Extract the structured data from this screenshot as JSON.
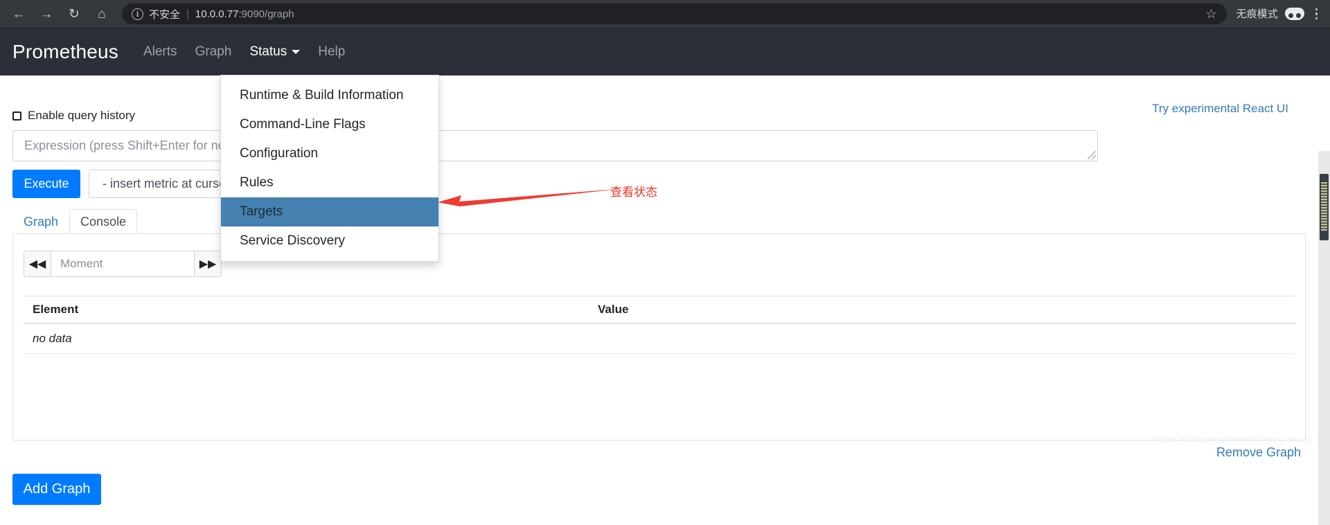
{
  "browser": {
    "back_icon": "back-arrow-icon",
    "forward_icon": "forward-arrow-icon",
    "reload_icon": "reload-icon",
    "home_icon": "home-icon",
    "info_icon": "info-icon",
    "security_label": "不安全",
    "url_separator": "|",
    "url_host": "10.0.0.77",
    "url_rest": ":9090/graph",
    "star_icon": "bookmark-star-icon",
    "incognito_label": "无痕模式",
    "incognito_icon": "incognito-glasses-icon",
    "menu_icon": "three-dot-menu-icon"
  },
  "navbar": {
    "brand": "Prometheus",
    "links": [
      {
        "label": "Alerts",
        "active": false
      },
      {
        "label": "Graph",
        "active": false
      },
      {
        "label": "Status",
        "active": true,
        "has_caret": true
      },
      {
        "label": "Help",
        "active": false
      }
    ]
  },
  "dropdown": {
    "items": [
      {
        "label": "Runtime & Build Information",
        "selected": false
      },
      {
        "label": "Command-Line Flags",
        "selected": false
      },
      {
        "label": "Configuration",
        "selected": false
      },
      {
        "label": "Rules",
        "selected": false
      },
      {
        "label": "Targets",
        "selected": true
      },
      {
        "label": "Service Discovery",
        "selected": false
      }
    ],
    "selected_bg": "#4481b0"
  },
  "main": {
    "react_ui_link": "Try experimental React UI",
    "query_history_label": "Enable query history",
    "query_history_checked": false,
    "expression_placeholder": "Expression (press Shift+Enter for newlines)",
    "expression_value": "",
    "execute_label": "Execute",
    "metric_select_label": "- insert metric at cursor -",
    "tabs": [
      {
        "label": "Graph",
        "active": false
      },
      {
        "label": "Console",
        "active": true
      }
    ],
    "step_back_icon": "double-chevron-left-icon",
    "step_back_glyph": "◀◀",
    "step_forward_icon": "double-chevron-right-icon",
    "step_forward_glyph": "▶▶",
    "moment_placeholder": "Moment",
    "moment_value": "",
    "table": {
      "columns": [
        "Element",
        "Value"
      ],
      "rows": [
        [
          "no data",
          ""
        ]
      ]
    },
    "remove_graph_label": "Remove Graph",
    "add_graph_label": "Add Graph"
  },
  "annotation": {
    "text": "查看状态",
    "color": "#e8362b",
    "arrow_icon": "red-arrow-icon"
  },
  "scrollbar": {
    "thumb_position": "near-top"
  },
  "watermark": "https://blog.csdn.net/chen_jimo_c"
}
